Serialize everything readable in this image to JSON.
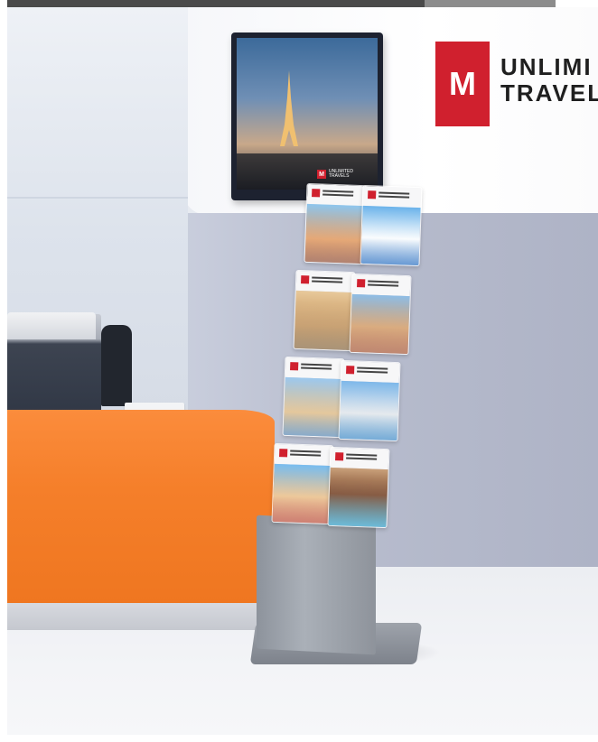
{
  "scene": {
    "sign": {
      "text": "UNLIMI\nTRAVEL",
      "mark": "M",
      "icon": "unlimited-travel-logo-icon",
      "color": "#d0202e"
    },
    "tv": {
      "caption": "UNLIMITED TRAVELS",
      "mark": "M"
    },
    "counter_color": "#f57f2a"
  }
}
